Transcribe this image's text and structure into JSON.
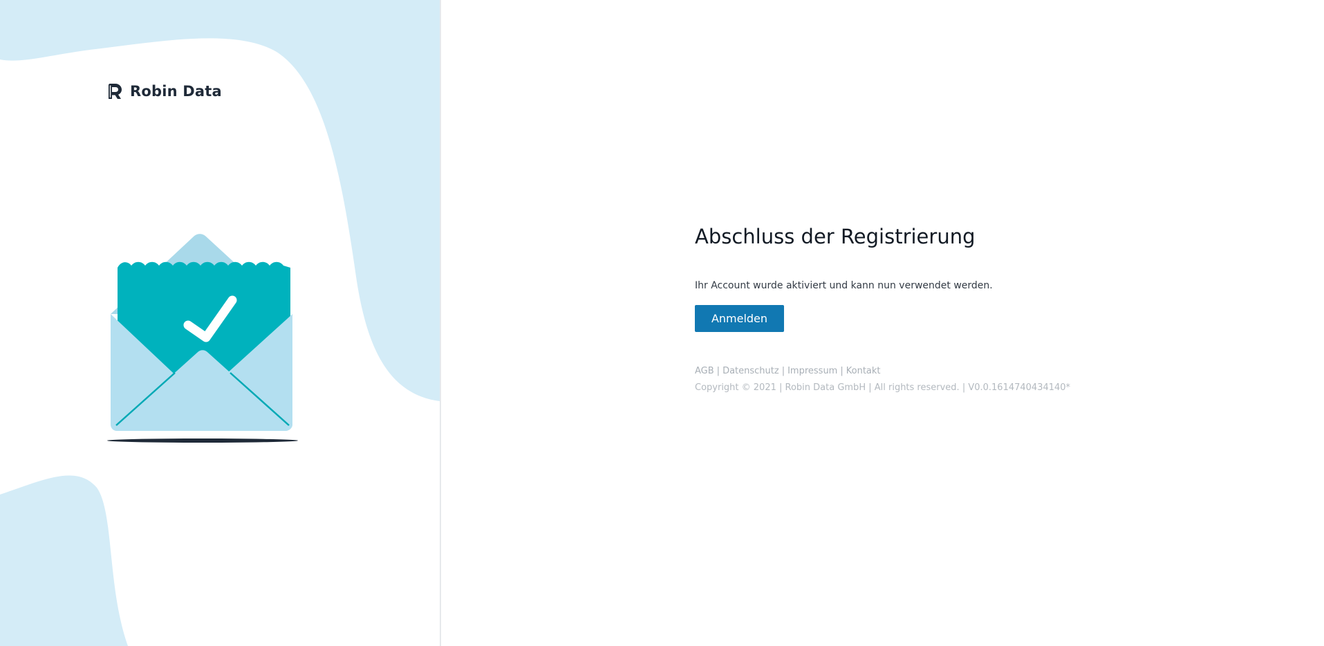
{
  "brand": {
    "name": "Robin Data",
    "logo_icon": "robin-data-r-logo-icon"
  },
  "illustration": {
    "icon": "envelope-checkmark-icon"
  },
  "main": {
    "title": "Abschluss der Registrierung",
    "message": "Ihr Account wurde aktiviert und kann nun verwendet werden.",
    "login_button_label": "Anmelden"
  },
  "footer": {
    "links": [
      {
        "label": "AGB"
      },
      {
        "label": "Datenschutz"
      },
      {
        "label": "Impressum"
      },
      {
        "label": "Kontakt"
      }
    ],
    "separator": "|",
    "copyright": "Copyright © 2021 | Robin Data GmbH | All rights reserved. | V0.0.1614740434140*"
  },
  "colors": {
    "accent_blue": "#1178b2",
    "teal": "#00b2bd",
    "light_blue": "#d4ecf7",
    "envelope_blue": "#b3dff0"
  }
}
